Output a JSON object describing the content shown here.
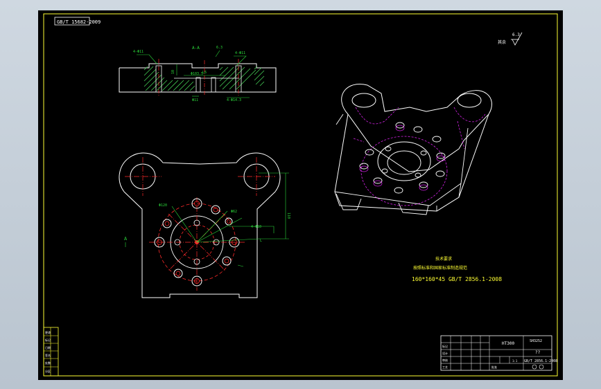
{
  "drawing": {
    "drawing_number_mirrored": "GB/T 15682-2009",
    "section_label": "A-A",
    "roughness": {
      "value": "6.3",
      "prefix": "其余"
    },
    "view_marker": "A",
    "dimensions": {
      "top_hole_left": "4-Φ11",
      "top_hole_right": "4-Φ11",
      "top_dia": "Φ103.5",
      "top_l6": "L6",
      "top_height": "10",
      "top_small": "Φ11",
      "top_right_bottom": "4-Φ14.3",
      "plan_d120": "Φ120",
      "plan_d62": "Φ62",
      "plan_holes": "4-Φ10",
      "plan_height": "110",
      "plan_l": "L"
    },
    "notes": {
      "title": "技术要求",
      "line1": "按照标准和国家标准制造规范",
      "line2": "160*160*45 GB/T 2856.1-2008"
    },
    "title_block": {
      "material": "HT300",
      "drawing_no": "SH3252",
      "part_name": "??",
      "scale": "1:1",
      "standard": "GB/T 2856.1-2008",
      "rows": [
        "标记",
        "设计",
        "审核",
        "工艺",
        "批准"
      ]
    },
    "revision_block": [
      "更改",
      "标记",
      "日期",
      "签名",
      "处数",
      "分区"
    ],
    "colors": {
      "outline": "#ffffff",
      "centerline": "#ff2a2a",
      "hatch": "#44cc55",
      "dimension": "#2bd93a",
      "hidden": "#d321e6",
      "notes": "#ffff33",
      "frame": "#ffff33"
    }
  }
}
